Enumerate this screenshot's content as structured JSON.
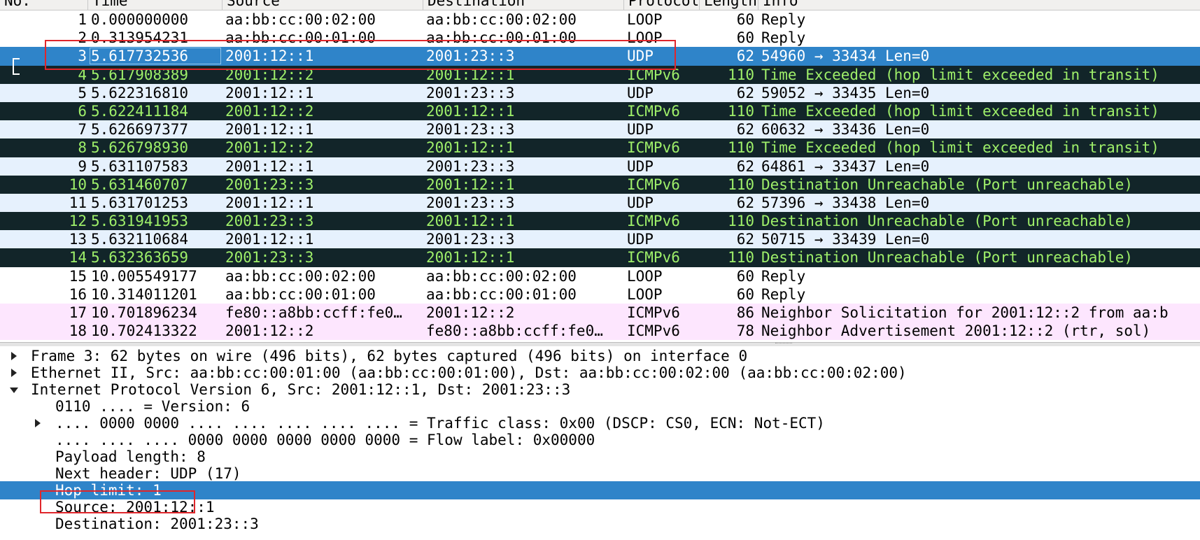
{
  "packet_list": {
    "columns": [
      "No.",
      "Time",
      "Source",
      "Destination",
      "Protocol",
      "Length",
      "Info"
    ],
    "rows": [
      {
        "no": "1",
        "time": "0.000000000",
        "source": "aa:bb:cc:00:02:00",
        "destination": "aa:bb:cc:00:02:00",
        "protocol": "LOOP",
        "length": "60",
        "info": "Reply",
        "style": "white"
      },
      {
        "no": "2",
        "time": "0.313954231",
        "source": "aa:bb:cc:00:01:00",
        "destination": "aa:bb:cc:00:01:00",
        "protocol": "LOOP",
        "length": "60",
        "info": "Reply",
        "style": "white"
      },
      {
        "no": "3",
        "time": "5.617732536",
        "source": "2001:12::1",
        "destination": "2001:23::3",
        "protocol": "UDP",
        "length": "62",
        "info": "54960 → 33434 Len=0",
        "style": "sel"
      },
      {
        "no": "4",
        "time": "5.617908389",
        "source": "2001:12::2",
        "destination": "2001:12::1",
        "protocol": "ICMPv6",
        "length": "110",
        "info": "Time Exceeded (hop limit exceeded in transit)",
        "style": "dark"
      },
      {
        "no": "5",
        "time": "5.622316810",
        "source": "2001:12::1",
        "destination": "2001:23::3",
        "protocol": "UDP",
        "length": "62",
        "info": "59052 → 33435 Len=0",
        "style": "blue"
      },
      {
        "no": "6",
        "time": "5.622411184",
        "source": "2001:12::2",
        "destination": "2001:12::1",
        "protocol": "ICMPv6",
        "length": "110",
        "info": "Time Exceeded (hop limit exceeded in transit)",
        "style": "dark"
      },
      {
        "no": "7",
        "time": "5.626697377",
        "source": "2001:12::1",
        "destination": "2001:23::3",
        "protocol": "UDP",
        "length": "62",
        "info": "60632 → 33436 Len=0",
        "style": "blue"
      },
      {
        "no": "8",
        "time": "5.626798930",
        "source": "2001:12::2",
        "destination": "2001:12::1",
        "protocol": "ICMPv6",
        "length": "110",
        "info": "Time Exceeded (hop limit exceeded in transit)",
        "style": "dark"
      },
      {
        "no": "9",
        "time": "5.631107583",
        "source": "2001:12::1",
        "destination": "2001:23::3",
        "protocol": "UDP",
        "length": "62",
        "info": "64861 → 33437 Len=0",
        "style": "blue"
      },
      {
        "no": "10",
        "time": "5.631460707",
        "source": "2001:23::3",
        "destination": "2001:12::1",
        "protocol": "ICMPv6",
        "length": "110",
        "info": "Destination Unreachable (Port unreachable)",
        "style": "dark"
      },
      {
        "no": "11",
        "time": "5.631701253",
        "source": "2001:12::1",
        "destination": "2001:23::3",
        "protocol": "UDP",
        "length": "62",
        "info": "57396 → 33438 Len=0",
        "style": "blue"
      },
      {
        "no": "12",
        "time": "5.631941953",
        "source": "2001:23::3",
        "destination": "2001:12::1",
        "protocol": "ICMPv6",
        "length": "110",
        "info": "Destination Unreachable (Port unreachable)",
        "style": "dark"
      },
      {
        "no": "13",
        "time": "5.632110684",
        "source": "2001:12::1",
        "destination": "2001:23::3",
        "protocol": "UDP",
        "length": "62",
        "info": "50715 → 33439 Len=0",
        "style": "blue"
      },
      {
        "no": "14",
        "time": "5.632363659",
        "source": "2001:23::3",
        "destination": "2001:12::1",
        "protocol": "ICMPv6",
        "length": "110",
        "info": "Destination Unreachable (Port unreachable)",
        "style": "dark"
      },
      {
        "no": "15",
        "time": "10.005549177",
        "source": "aa:bb:cc:00:02:00",
        "destination": "aa:bb:cc:00:02:00",
        "protocol": "LOOP",
        "length": "60",
        "info": "Reply",
        "style": "white"
      },
      {
        "no": "16",
        "time": "10.314011201",
        "source": "aa:bb:cc:00:01:00",
        "destination": "aa:bb:cc:00:01:00",
        "protocol": "LOOP",
        "length": "60",
        "info": "Reply",
        "style": "white"
      },
      {
        "no": "17",
        "time": "10.701896234",
        "source": "fe80::a8bb:ccff:fe0…",
        "destination": "2001:12::2",
        "protocol": "ICMPv6",
        "length": "86",
        "info": "Neighbor Solicitation for 2001:12::2 from aa:b",
        "style": "pink"
      },
      {
        "no": "18",
        "time": "10.702413322",
        "source": "2001:12::2",
        "destination": "fe80::a8bb:ccff:fe0…",
        "protocol": "ICMPv6",
        "length": "78",
        "info": "Neighbor Advertisement 2001:12::2 (rtr, sol)",
        "style": "pink"
      }
    ]
  },
  "packet_detail": {
    "items": [
      {
        "indent": 0,
        "arrow": "right",
        "text": "Frame 3: 62 bytes on wire (496 bits), 62 bytes captured (496 bits) on interface 0",
        "style": "level0"
      },
      {
        "indent": 0,
        "arrow": "right",
        "text": "Ethernet II, Src: aa:bb:cc:00:01:00 (aa:bb:cc:00:01:00), Dst: aa:bb:cc:00:02:00 (aa:bb:cc:00:02:00)",
        "style": "level0"
      },
      {
        "indent": 0,
        "arrow": "down",
        "text": "Internet Protocol Version 6, Src: 2001:12::1, Dst: 2001:23::3",
        "style": "level0"
      },
      {
        "indent": 1,
        "arrow": "none",
        "text": "0110 .... = Version: 6",
        "style": "normal"
      },
      {
        "indent": 1,
        "arrow": "right",
        "text": ".... 0000 0000 .... .... .... .... .... = Traffic class: 0x00 (DSCP: CS0, ECN: Not-ECT)",
        "style": "normal"
      },
      {
        "indent": 1,
        "arrow": "none",
        "text": ".... .... .... 0000 0000 0000 0000 0000 = Flow label: 0x00000",
        "style": "normal"
      },
      {
        "indent": 1,
        "arrow": "none",
        "text": "Payload length: 8",
        "style": "normal"
      },
      {
        "indent": 1,
        "arrow": "none",
        "text": "Next header: UDP (17)",
        "style": "normal"
      },
      {
        "indent": 1,
        "arrow": "none",
        "text": "Hop limit: 1",
        "style": "sel"
      },
      {
        "indent": 1,
        "arrow": "none",
        "text": "Source: 2001:12::1",
        "style": "normal"
      },
      {
        "indent": 1,
        "arrow": "none",
        "text": "Destination: 2001:23::3",
        "style": "normal"
      }
    ]
  },
  "colors": {
    "selected": "#2f84c9",
    "dark_row": "#122529",
    "dark_row_text": "#9ff06a",
    "udp_row": "#e6f1fd",
    "ndp_row": "#fde6fe",
    "annotation": "#e0262b"
  }
}
